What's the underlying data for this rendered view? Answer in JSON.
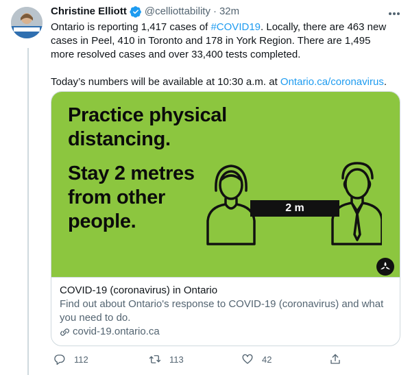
{
  "tweet": {
    "display_name": "Christine Elliott",
    "handle": "@celliottability",
    "separator": "·",
    "time": "32m",
    "text_line1_a": "Ontario is reporting 1,417 cases of ",
    "hashtag": "#COVID19",
    "text_line1_b": ". Locally, there are 463 new cases in Peel, 410 in Toronto and 178 in York Region. There are 1,495 more resolved cases and over 33,400 tests completed.",
    "text_line2_a": "Today’s numbers will be available at 10:30 a.m. at ",
    "link_text": "Ontario.ca/coronavirus",
    "text_line2_b": "."
  },
  "card": {
    "image_headline": "Practice physical\ndistancing.",
    "image_subline": "Stay 2 metres\nfrom other\npeople.",
    "distance_label": "2 m",
    "title": "COVID-19 (coronavirus) in Ontario",
    "description": "Find out about Ontario's response to COVID-19 (coronavirus) and what you need to do.",
    "domain": "covid-19.ontario.ca"
  },
  "actions": {
    "replies": "112",
    "retweets": "113",
    "likes": "42"
  },
  "icons": {
    "verified": "verified-badge-icon",
    "more": "more-options-icon",
    "reply": "reply-icon",
    "retweet": "retweet-icon",
    "like": "heart-icon",
    "share": "share-icon",
    "link": "link-icon",
    "ontario_logo": "ontario-trillium-logo"
  },
  "colors": {
    "accent": "#1d9bf0",
    "card_bg": "#8cc63f",
    "muted": "#536471"
  }
}
